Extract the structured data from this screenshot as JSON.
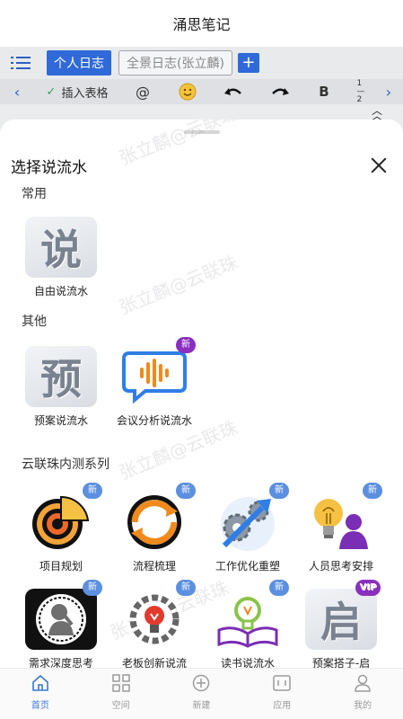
{
  "app": {
    "title": "涌思笔记"
  },
  "tabs": {
    "active": "个人日志",
    "other": "全景日志(张立麟)",
    "add": "+"
  },
  "toolbar": {
    "left_arrow": "‹",
    "insert_table": "插入表格",
    "mention": "@",
    "bold": "B",
    "right_arrow": "›"
  },
  "sheet": {
    "title": "选择说流水",
    "watermark": "张立麟@云联珠",
    "sections": {
      "common": {
        "title": "常用",
        "items": [
          {
            "label": "自由说流水",
            "char": "说"
          }
        ]
      },
      "other": {
        "title": "其他",
        "items": [
          {
            "label": "预案说流水",
            "char": "预"
          },
          {
            "label": "会议分析说流水",
            "badge": "新"
          }
        ]
      },
      "series": {
        "title": "云联珠内测系列",
        "row1": [
          {
            "label": "项目规划",
            "badge": "新"
          },
          {
            "label": "流程梳理",
            "badge": "新"
          },
          {
            "label": "工作优化重塑",
            "badge": "新"
          },
          {
            "label": "人员思考安排",
            "badge": "新"
          }
        ],
        "row2": [
          {
            "label": "需求深度思考",
            "badge": "新"
          },
          {
            "label": "老板创新说流",
            "badge": "新"
          },
          {
            "label": "读书说流水",
            "badge": "新"
          },
          {
            "label": "预案搭子-启",
            "badge": "VIP",
            "char": "启"
          }
        ]
      }
    }
  },
  "bottom_nav": [
    {
      "label": "首页",
      "icon": "home-icon"
    },
    {
      "label": "空间",
      "icon": "grid-icon"
    },
    {
      "label": "新建",
      "icon": "plus-circle-icon"
    },
    {
      "label": "应用",
      "icon": "app-frame-icon"
    },
    {
      "label": "我的",
      "icon": "user-icon"
    }
  ],
  "colors": {
    "accent": "#2f6ad8",
    "badge_blue": "#5b8fe0",
    "badge_purple": "#8a2fc0",
    "nav_active": "#3a78d6"
  }
}
